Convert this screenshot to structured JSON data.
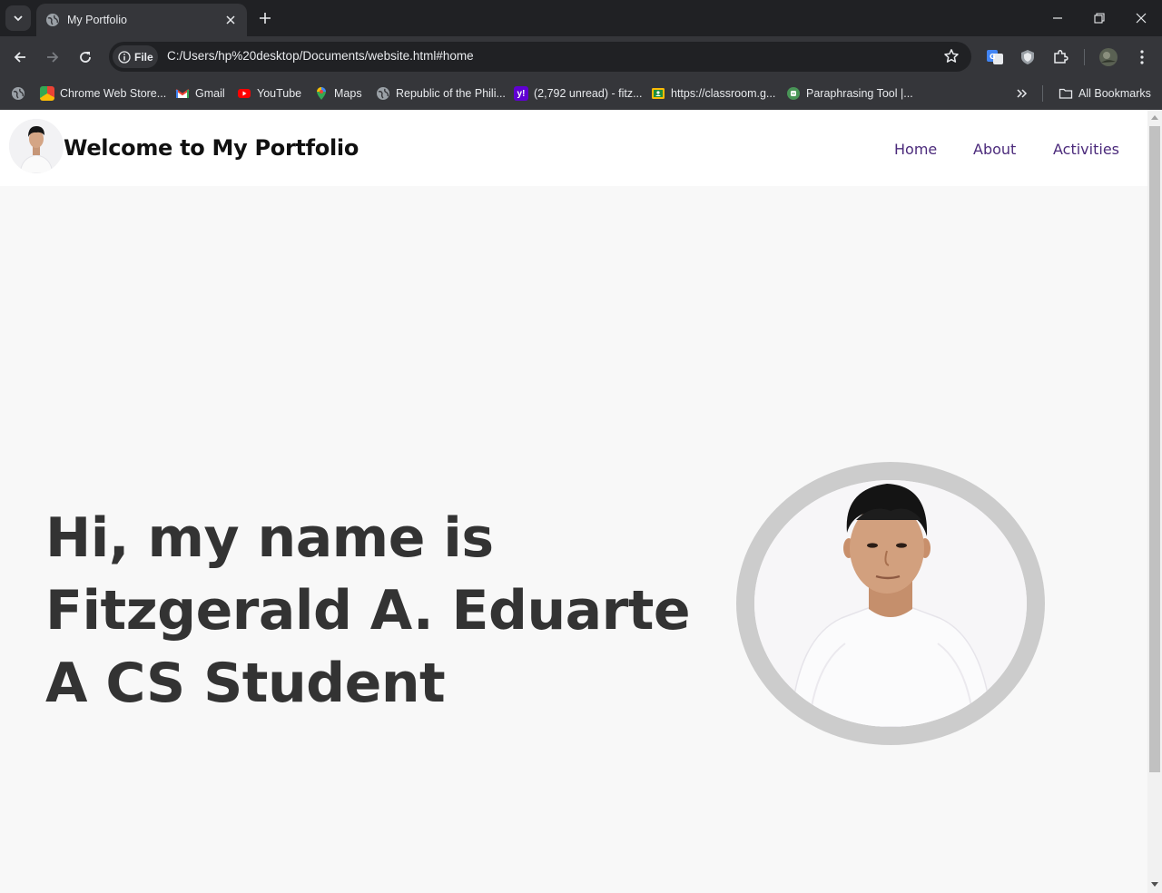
{
  "browser": {
    "tab_title": "My Portfolio",
    "url_chip": "File",
    "url": "C:/Users/hp%20desktop/Documents/website.html#home",
    "bookmarks": [
      "Chrome Web Store...",
      "Gmail",
      "YouTube",
      "Maps",
      "Republic of the Phili...",
      "(2,792 unread) - fitz...",
      "https://classroom.g...",
      "Paraphrasing Tool |..."
    ],
    "all_bookmarks": "All Bookmarks"
  },
  "site": {
    "title": "Welcome to My Portfolio",
    "nav": [
      "Home",
      "About",
      "Activities"
    ],
    "hero": {
      "line1": "Hi, my name is",
      "line2": "Fitzgerald A. Eduarte",
      "line3": "A CS Student"
    }
  },
  "colors": {
    "nav_link": "#4b2a7b",
    "hero_text": "#333333",
    "page_bg": "#f8f8f8",
    "ring": "#cccccc"
  }
}
